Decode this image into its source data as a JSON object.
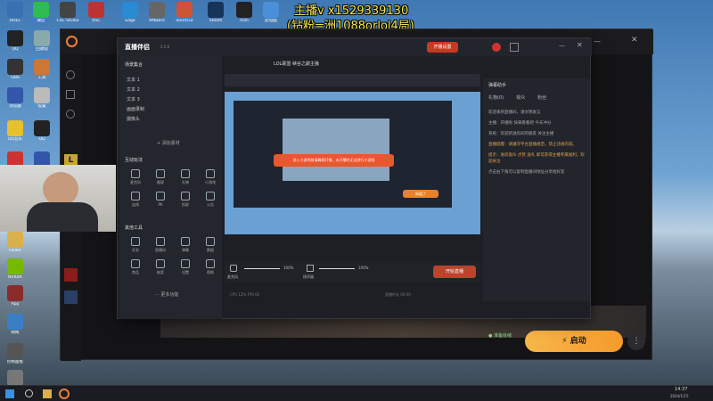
{
  "overlay": {
    "line1": "主播v x1529339130",
    "line2": "(钻粉=洲1088orlol4局)"
  },
  "desktop_icons": [
    {
      "label": "DOEC",
      "color": "#3a6fb0"
    },
    {
      "label": "微信",
      "color": "#2ebc4f"
    },
    {
      "label": "CSC Studio",
      "color": "#444"
    },
    {
      "label": "RSC",
      "color": "#b33"
    },
    {
      "label": "Edge",
      "color": "#2a8ad4"
    },
    {
      "label": "VMware",
      "color": "#666"
    },
    {
      "label": "Shortcut",
      "color": "#c53"
    },
    {
      "label": "Steam",
      "color": "#16345a"
    },
    {
      "label": "Icon",
      "color": "#222"
    },
    {
      "label": "此电脑",
      "color": "#4a90d9"
    },
    {
      "label": "QQ",
      "color": "#222"
    },
    {
      "label": "回收站",
      "color": "#8aa"
    },
    {
      "label": "OBS",
      "color": "#333"
    },
    {
      "label": "工具",
      "color": "#c73"
    },
    {
      "label": "浏览器",
      "color": "#35a"
    },
    {
      "label": "设置",
      "color": "#bbb"
    },
    {
      "label": "QQ音乐",
      "color": "#e6c12e"
    },
    {
      "label": "QQ",
      "color": "#222"
    },
    {
      "label": "WeGame",
      "color": "#c33"
    },
    {
      "label": "Tasks",
      "color": "#35a"
    },
    {
      "label": "Folder",
      "color": "#d9b04a"
    },
    {
      "label": "NVIDIA",
      "color": "#76b900"
    },
    {
      "label": "App",
      "color": "#8a2a2a"
    },
    {
      "label": "网络",
      "color": "#3a7fc6"
    },
    {
      "label": "控制面板",
      "color": "#555"
    },
    {
      "label": "设置",
      "color": "#777"
    }
  ],
  "streamer": {
    "title": "直播伴侣",
    "version": "5.5.6",
    "top_tab": "LOL联盟 峡谷之巅主播",
    "record_btn": "开播设置",
    "scenes_title": "场景集合",
    "scenes_add": "+ 添加素材",
    "scene_items": [
      "文本 1",
      "文本 2",
      "文本 3",
      "画面录制",
      "摄像头"
    ],
    "interact_title": "互动玩法",
    "interact_tools": [
      "麦克风",
      "截屏",
      "礼物",
      "小游戏",
      "连线",
      "PK",
      "投屏",
      "公告"
    ],
    "func_title": "其他工具",
    "func_tools": [
      "任务",
      "直播间",
      "弹幕",
      "数据",
      "商品",
      "抽奖",
      "设置",
      "帮助"
    ],
    "more": "··· 更多功能",
    "dialog": "进入小游戏前请确保开播，未开播时无法进行小游戏",
    "dialog_btn": "知道了",
    "mic_label": "麦克风",
    "spk_label": "扬声器",
    "mic_val": "100%",
    "spk_val": "100%",
    "start_live": "开始直播",
    "status_left": "CPU 12%  FPS 60",
    "stats": "直播时长 00:00",
    "chat_title": "弹幕助手",
    "chat_tabs": [
      "礼物(0)",
      "观众",
      "粉丝"
    ],
    "chat_lines": [
      {
        "text": "欢迎来到直播间，请文明发言",
        "orange": false
      },
      {
        "text": "主播：开播啦 快来看看吧 今天冲分",
        "orange": false
      },
      {
        "text": "系统：欢迎新进房间的朋友 关注主播",
        "orange": false
      },
      {
        "text": "直播提醒：请遵守平台直播规范，禁止违规内容。",
        "orange": true
      },
      {
        "text": "提示：进房观众 点赞 送礼 即可获得主播专属福利，欢迎关注",
        "orange": true
      },
      {
        "text": "点击右下角可以复制直播间地址分享给好友",
        "orange": false
      }
    ]
  },
  "launch": {
    "label": "启动",
    "secondary": "● 准备就绪"
  },
  "taskbar": {
    "time": "14:37",
    "date": "2024/1/15"
  }
}
